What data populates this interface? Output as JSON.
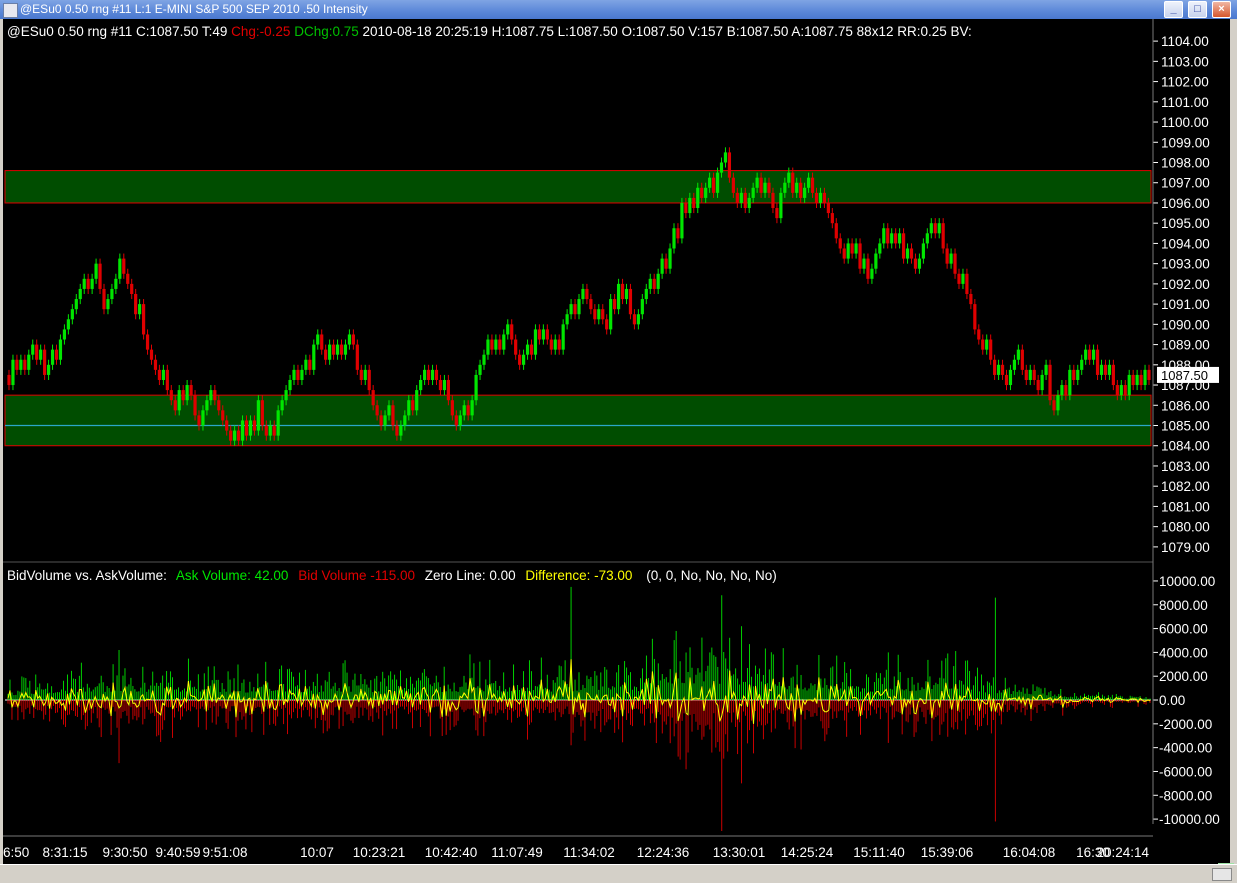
{
  "window": {
    "title": "@ESu0  0.50 rng  #11  L:1  E-MINI S&P 500 SEP 2010  .50 Intensity",
    "minimize_label": "_",
    "maximize_label": "□",
    "close_label": "×"
  },
  "header": {
    "symbol_info": "@ESu0  0.50 rng  #11 C:1087.50 T:49",
    "chg": "Chg:-0.25",
    "dchg": "DChg:0.75",
    "rest": "2010-08-18 20:25:19 H:1087.75 L:1087.50 O:1087.50 V:157 B:1087.50 A:1087.75 88x12 RR:0.25 BV:"
  },
  "indicator_header": {
    "title": "BidVolume vs. AskVolume:",
    "ask": "Ask Volume: 42.00",
    "bid": "Bid Volume  -115.00",
    "zero": "Zero Line: 0.00",
    "diff": "Difference: -73.00",
    "params": "(0, 0, No, No, No, No)"
  },
  "last_price_label": "1087.50",
  "page_badge": "1",
  "colors": {
    "background": "#000000",
    "up_bar": "#00e600",
    "down_bar": "#e00000",
    "zone_fill": "#004d00",
    "zone_border": "#e00000",
    "zero_line": "#ffffff",
    "difference_line": "#ffff00",
    "text": "#ffffff",
    "chg": "#e00000",
    "dchg": "#00c000",
    "ask": "#00e600",
    "bid": "#e00000",
    "diff": "#ffff00"
  },
  "chart_data": [
    {
      "type": "candlestick",
      "description_free": true,
      "price_axis": {
        "ylim": [
          1078.5,
          1104.5
        ],
        "ticks": [
          "1104.00",
          "1103.00",
          "1102.00",
          "1101.00",
          "1100.00",
          "1099.00",
          "1098.00",
          "1097.00",
          "1096.00",
          "1095.00",
          "1094.00",
          "1093.00",
          "1092.00",
          "1091.00",
          "1090.00",
          "1089.00",
          "1088.00",
          "1087.00",
          "1086.00",
          "1085.00",
          "1084.00",
          "1083.00",
          "1082.00",
          "1081.00",
          "1080.00",
          "1079.00"
        ]
      },
      "zones": [
        {
          "low": 1096.0,
          "high": 1097.6
        },
        {
          "low": 1084.0,
          "high": 1086.5
        }
      ],
      "horizontal_line": 1085.0,
      "price_path": [
        [
          0,
          1087.5
        ],
        [
          4,
          1088.5
        ],
        [
          9,
          1087.8
        ],
        [
          14,
          1089.5
        ],
        [
          19,
          1091.8
        ],
        [
          22,
          1092.6
        ],
        [
          24,
          1091.0
        ],
        [
          28,
          1092.8
        ],
        [
          31,
          1091.4
        ],
        [
          35,
          1089.0
        ],
        [
          38,
          1087.4
        ],
        [
          41,
          1086.5
        ],
        [
          45,
          1087.0
        ],
        [
          48,
          1085.2
        ],
        [
          52,
          1086.2
        ],
        [
          56,
          1084.4
        ],
        [
          60,
          1085.0
        ],
        [
          63,
          1085.8
        ],
        [
          66,
          1084.2
        ],
        [
          69,
          1086.0
        ],
        [
          73,
          1087.8
        ],
        [
          77,
          1089.0
        ],
        [
          81,
          1088.6
        ],
        [
          86,
          1089.3
        ],
        [
          90,
          1087.0
        ],
        [
          94,
          1085.5
        ],
        [
          98,
          1084.8
        ],
        [
          102,
          1086.2
        ],
        [
          106,
          1087.3
        ],
        [
          110,
          1086.8
        ],
        [
          113,
          1085.0
        ],
        [
          117,
          1086.3
        ],
        [
          121,
          1089.0
        ],
        [
          126,
          1089.6
        ],
        [
          130,
          1088.2
        ],
        [
          134,
          1090.0
        ],
        [
          138,
          1089.0
        ],
        [
          142,
          1090.4
        ],
        [
          146,
          1091.6
        ],
        [
          150,
          1090.5
        ],
        [
          154,
          1091.5
        ],
        [
          158,
          1090.3
        ],
        [
          162,
          1091.8
        ],
        [
          166,
          1093.5
        ],
        [
          170,
          1095.5
        ],
        [
          174,
          1097.2
        ],
        [
          177,
          1096.2
        ],
        [
          181,
          1098.0
        ],
        [
          183,
          1096.6
        ],
        [
          186,
          1095.6
        ],
        [
          190,
          1096.5
        ],
        [
          194,
          1095.8
        ],
        [
          198,
          1096.8
        ],
        [
          202,
          1096.4
        ],
        [
          206,
          1096.0
        ],
        [
          209,
          1094.2
        ],
        [
          213,
          1093.6
        ],
        [
          217,
          1092.6
        ],
        [
          221,
          1094.5
        ],
        [
          225,
          1094.0
        ],
        [
          229,
          1093.0
        ],
        [
          233,
          1094.6
        ],
        [
          237,
          1093.4
        ],
        [
          240,
          1092.6
        ],
        [
          244,
          1090.0
        ],
        [
          248,
          1088.0
        ],
        [
          252,
          1087.2
        ],
        [
          256,
          1088.0
        ],
        [
          260,
          1087.4
        ],
        [
          264,
          1086.2
        ],
        [
          268,
          1087.8
        ],
        [
          272,
          1088.4
        ],
        [
          276,
          1087.4
        ],
        [
          280,
          1086.6
        ],
        [
          284,
          1087.7
        ],
        [
          288,
          1088.0
        ]
      ],
      "x_tick_labels": [
        "6:50",
        "8:31:15",
        "9:30:50",
        "9:40:59",
        "9:51:08",
        "10:07",
        "10:23:21",
        "10:42:40",
        "11:07:49",
        "11:34:02",
        "12:24:36",
        "13:30:01",
        "14:25:24",
        "15:11:40",
        "15:39:06",
        "16:04:08",
        "16:30",
        "20:24:14"
      ],
      "last_price": 1087.5
    },
    {
      "type": "bar",
      "title": "BidVolume vs. AskVolume",
      "volume_axis": {
        "ylim": [
          -11000,
          10500
        ],
        "ticks": [
          "10000.00",
          "8000.00",
          "6000.00",
          "4000.00",
          "2000.00",
          "0.00",
          "-2000.00",
          "-4000.00",
          "-6000.00",
          "-8000.00",
          "-10000.00"
        ]
      },
      "series": [
        {
          "name": "Ask Volume",
          "last": 42.0
        },
        {
          "name": "Bid Volume",
          "last": -115.0
        },
        {
          "name": "Zero Line",
          "last": 0.0
        },
        {
          "name": "Difference",
          "last": -73.0
        }
      ],
      "activity_envelope": [
        [
          0,
          1500
        ],
        [
          20,
          2600
        ],
        [
          40,
          2800
        ],
        [
          60,
          2500
        ],
        [
          80,
          2700
        ],
        [
          100,
          2600
        ],
        [
          120,
          2800
        ],
        [
          140,
          2700
        ],
        [
          160,
          3000
        ],
        [
          170,
          5600
        ],
        [
          180,
          5200
        ],
        [
          190,
          4200
        ],
        [
          200,
          3200
        ],
        [
          220,
          2600
        ],
        [
          240,
          3400
        ],
        [
          250,
          2000
        ],
        [
          260,
          1600
        ],
        [
          270,
          600
        ],
        [
          288,
          400
        ]
      ],
      "spikes": [
        {
          "x": 142,
          "ask": 9500,
          "bid": -3800
        },
        {
          "x": 180,
          "ask": 8800,
          "bid": -11000
        },
        {
          "x": 249,
          "ask": 8600,
          "bid": -10200
        },
        {
          "x": 222,
          "ask": 4000,
          "bid": -3600
        },
        {
          "x": 28,
          "ask": 4200,
          "bid": -5300
        },
        {
          "x": 185,
          "ask": 6200,
          "bid": -7000
        }
      ]
    }
  ]
}
